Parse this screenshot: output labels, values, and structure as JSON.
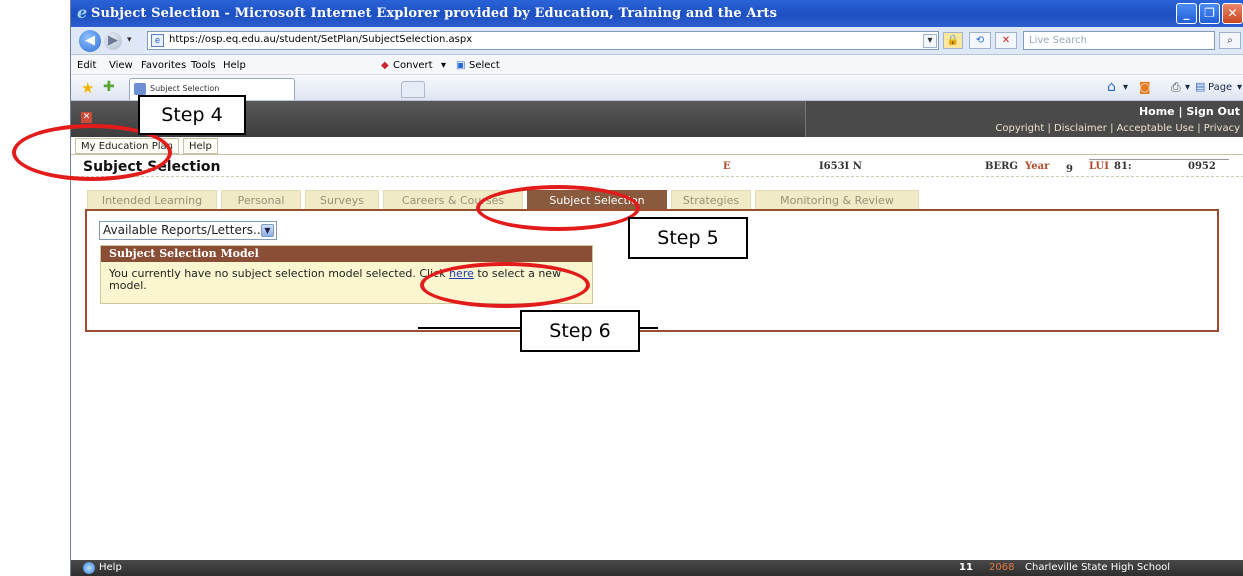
{
  "window": {
    "title": "Subject Selection - Microsoft Internet Explorer provided by Education, Training and the Arts",
    "minimize": "_",
    "maximize": "❐",
    "close": "✕"
  },
  "address": {
    "url": "https://osp.eq.edu.au/student/SetPlan/SubjectSelection.aspx",
    "search_placeholder": "Live Search"
  },
  "menu": {
    "items": [
      "Edit",
      "View",
      "Favorites",
      "Tools",
      "Help"
    ],
    "convert_label": "Convert",
    "select_label": "Select"
  },
  "favorites_bar": {
    "tab_title": "Subject Selection",
    "page_label": "Page",
    "tools_label": "Tools"
  },
  "site_header": {
    "home": "Home",
    "sign_out": "Sign Out",
    "footer_links": [
      "Copyright",
      "Disclaimer",
      "Acceptable Use",
      "Privacy"
    ]
  },
  "site_nav": {
    "items": [
      "My Education Plan",
      "Help"
    ]
  },
  "student": {
    "page_title": "Subject Selection",
    "field_e": "E",
    "field_id": "I653I N",
    "field_name": "BERG",
    "year_label": "Year",
    "year_value": "9",
    "lui_label": "LUI",
    "lui_value_a": "81:",
    "lui_value_b": "0952"
  },
  "tabs": [
    {
      "label": "Intended Learning",
      "active": false
    },
    {
      "label": "Personal",
      "active": false
    },
    {
      "label": "Surveys",
      "active": false
    },
    {
      "label": "Careers & Courses",
      "active": false
    },
    {
      "label": "Subject Selection",
      "active": true
    },
    {
      "label": "Strategies",
      "active": false
    },
    {
      "label": "Monitoring & Review",
      "active": false
    }
  ],
  "content": {
    "reports_select": "Available Reports/Letters...",
    "model_header": "Subject Selection Model",
    "model_msg_pre": "You currently have no subject selection model selected.  Click ",
    "model_msg_link": "here",
    "model_msg_post": " to select a new model."
  },
  "statusbar": {
    "help": "Help",
    "count": "11",
    "year": "2068",
    "school": "Charleville State High School"
  },
  "annotations": {
    "step4": "Step 4",
    "step5": "Step 5",
    "step6": "Step 6"
  },
  "colors": {
    "accent_brown": "#8a5a3f",
    "annotation_red": "#e21b1b",
    "title_blue": "#2a63d8"
  }
}
